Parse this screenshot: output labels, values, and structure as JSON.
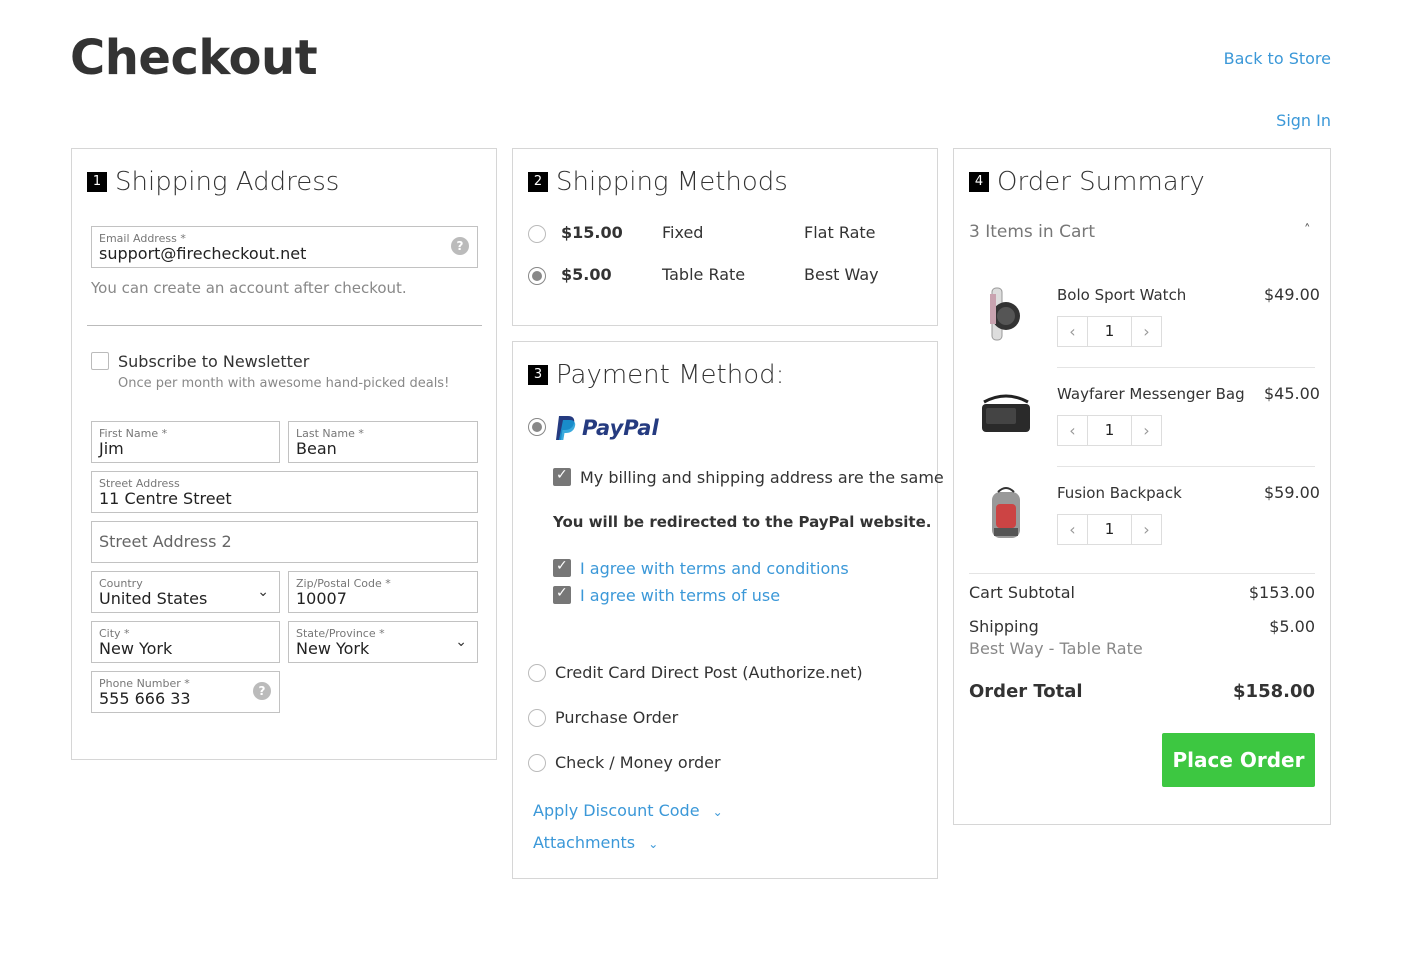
{
  "header": {
    "title": "Checkout",
    "back_link": "Back to Store",
    "signin_link": "Sign In"
  },
  "shipping_address": {
    "step": "1",
    "title": "Shipping Address",
    "email": {
      "label": "Email Address *",
      "value": "support@firecheckout.net"
    },
    "email_note": "You can create an account after checkout.",
    "newsletter": {
      "label": "Subscribe to Newsletter",
      "note": "Once per month with awesome hand-picked deals!",
      "checked": false
    },
    "first_name": {
      "label": "First Name *",
      "value": "Jim"
    },
    "last_name": {
      "label": "Last Name *",
      "value": "Bean"
    },
    "street": {
      "label": "Street Address",
      "value": "11 Centre Street"
    },
    "street2": {
      "placeholder": "Street Address 2"
    },
    "country": {
      "label": "Country",
      "value": "United States"
    },
    "zip": {
      "label": "Zip/Postal Code *",
      "value": "10007"
    },
    "city": {
      "label": "City *",
      "value": "New York"
    },
    "state": {
      "label": "State/Province *",
      "value": "New York"
    },
    "phone": {
      "label": "Phone Number *",
      "value": "555 666 33"
    }
  },
  "shipping_methods": {
    "step": "2",
    "title": "Shipping Methods",
    "options": [
      {
        "price": "$15.00",
        "method": "Fixed",
        "carrier": "Flat Rate",
        "selected": false
      },
      {
        "price": "$5.00",
        "method": "Table Rate",
        "carrier": "Best Way",
        "selected": true
      }
    ]
  },
  "payment": {
    "step": "3",
    "title": "Payment Method:",
    "paypal_label": "PayPal",
    "same_address": "My billing and shipping address are the same",
    "redirect_note": "You will be redirected to the PayPal website.",
    "agree_terms": "I agree with terms and conditions",
    "agree_use": "I agree with terms of use",
    "other_methods": [
      "Credit Card Direct Post (Authorize.net)",
      "Purchase Order",
      "Check / Money order"
    ],
    "discount_link": "Apply Discount Code",
    "attachments_link": "Attachments"
  },
  "summary": {
    "step": "4",
    "title": "Order Summary",
    "items_count": "3 Items in Cart",
    "items": [
      {
        "name": "Bolo Sport Watch",
        "price": "$49.00",
        "qty": "1"
      },
      {
        "name": "Wayfarer Messenger Bag",
        "price": "$45.00",
        "qty": "1"
      },
      {
        "name": "Fusion Backpack",
        "price": "$59.00",
        "qty": "1"
      }
    ],
    "subtotal_label": "Cart Subtotal",
    "subtotal_value": "$153.00",
    "shipping_label": "Shipping",
    "shipping_value": "$5.00",
    "shipping_method": "Best Way - Table Rate",
    "total_label": "Order Total",
    "total_value": "$158.00",
    "place_order": "Place Order"
  },
  "colors": {
    "link": "#3b98d8",
    "button": "#3dc741",
    "border": "#d6d6d6"
  }
}
